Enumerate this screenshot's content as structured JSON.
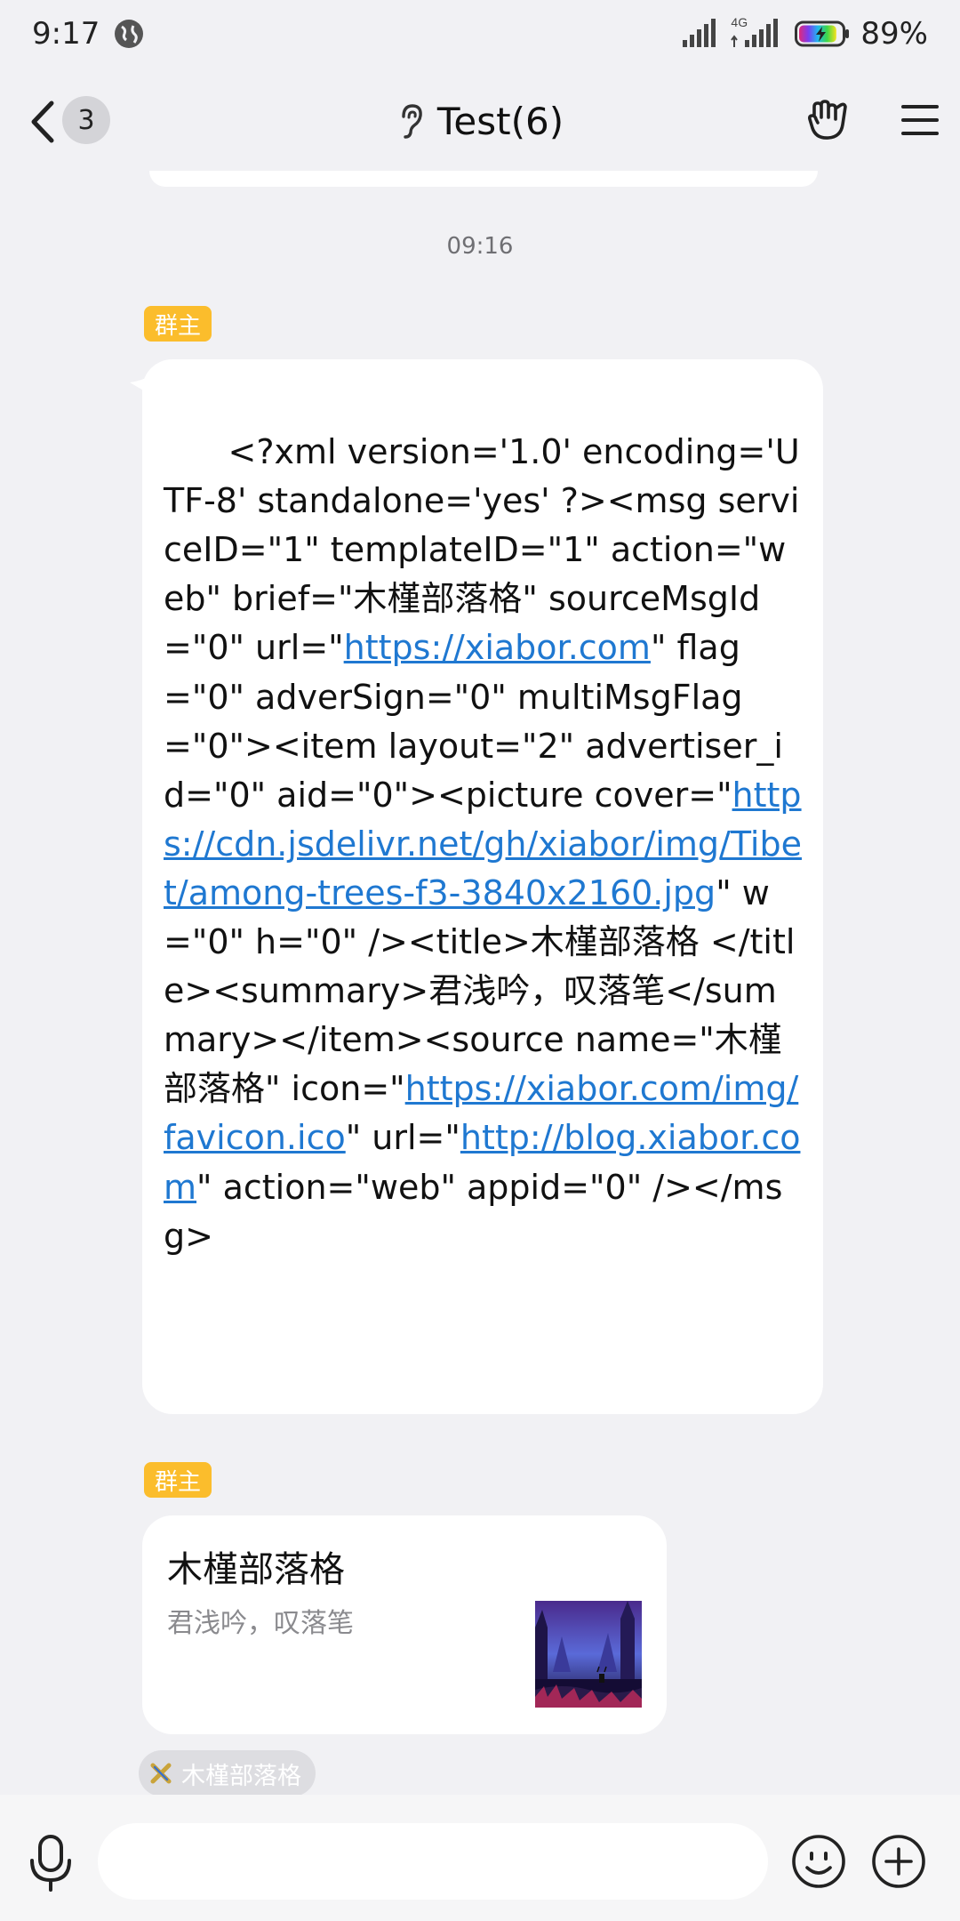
{
  "status_bar": {
    "time": "9:17",
    "network_label": "4G",
    "battery_percent": "89%",
    "battery_level": 0.89,
    "icons": [
      "globe-icon",
      "signal-icon",
      "4g-signal-icon",
      "battery-icon"
    ]
  },
  "nav": {
    "back_badge": "3",
    "title": "Test(6)",
    "icons": [
      "back-arrow-icon",
      "ear-icon",
      "hand-gesture-icon",
      "menu-icon"
    ]
  },
  "chat": {
    "timestamp": "09:16",
    "messages": [
      {
        "role_badge": "群主",
        "type": "text",
        "segments": [
          {
            "text": "<?xml version='1.0' encoding='UTF-8' standalone='yes' ?><msg serviceID=\"1\" templateID=\"1\" action=\"web\" brief=\"木槿部落格\" sourceMsgId=\"0\" url=\"",
            "link": false
          },
          {
            "text": "https://xiabor.com",
            "link": true
          },
          {
            "text": "\" flag=\"0\" adverSign=\"0\" multiMsgFlag=\"0\"><item layout=\"2\" advertiser_id=\"0\" aid=\"0\"><picture cover=\"",
            "link": false
          },
          {
            "text": "https://cdn.jsdelivr.net/gh/xiabor/img/Tibet/among-trees-f3-3840x2160.jpg",
            "link": true
          },
          {
            "text": "\" w=\"0\" h=\"0\" /><title>木槿部落格 </title><summary>君浅吟，叹落笔</summary></item><source name=\"木槿部落格\" icon=\"",
            "link": false
          },
          {
            "text": "https://xiabor.com/img/favicon.ico",
            "link": true
          },
          {
            "text": "\" url=\"",
            "link": false
          },
          {
            "text": "http://blog.xiabor.com",
            "link": true
          },
          {
            "text": "\" action=\"web\" appid=\"0\" /></msg>",
            "link": false
          }
        ]
      },
      {
        "role_badge": "群主",
        "type": "card",
        "card": {
          "title": "木槿部落格",
          "summary": "君浅吟，叹落笔",
          "source_name": "木槿部落格"
        }
      }
    ]
  },
  "bottom_bar": {
    "icons": [
      "microphone-icon",
      "emoji-icon",
      "plus-icon"
    ]
  },
  "colors": {
    "background": "#f1f1f4",
    "bubble": "#ffffff",
    "badge": "#fbbd2c",
    "link": "#1f78d1"
  }
}
